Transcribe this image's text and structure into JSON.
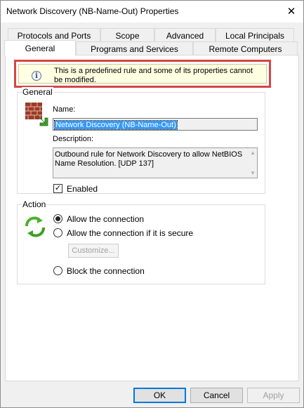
{
  "window": {
    "title": "Network Discovery (NB-Name-Out) Properties",
    "close_glyph": "✕"
  },
  "tabs": {
    "row1": [
      "Protocols and Ports",
      "Scope",
      "Advanced",
      "Local Principals"
    ],
    "row2": [
      "General",
      "Programs and Services",
      "Remote Computers"
    ],
    "active": "General"
  },
  "notice": {
    "icon": "info-icon",
    "icon_glyph": "i",
    "text": "This is a predefined rule and some of its properties cannot be modified."
  },
  "general": {
    "group_label": "General",
    "icon": "firewall-rule-icon",
    "name_label": "Name:",
    "name_value": "Network Discovery (NB-Name-Out)",
    "description_label": "Description:",
    "description_value": "Outbound rule for Network Discovery to allow NetBIOS Name Resolution. [UDP 137]",
    "enabled_label": "Enabled",
    "enabled": true,
    "check_glyph": "✓"
  },
  "action": {
    "group_label": "Action",
    "icon": "refresh-arrows-icon",
    "options": [
      "Allow the connection",
      "Allow the connection if it is secure",
      "Block the connection"
    ],
    "selected": "Allow the connection",
    "customize_label": "Customize..."
  },
  "footer": {
    "ok_label": "OK",
    "cancel_label": "Cancel",
    "apply_label": "Apply"
  },
  "colors": {
    "highlight_border": "#d64545",
    "notice_bg": "#ffffe1",
    "selection": "#3399ff",
    "default_button_border": "#0078d7"
  }
}
